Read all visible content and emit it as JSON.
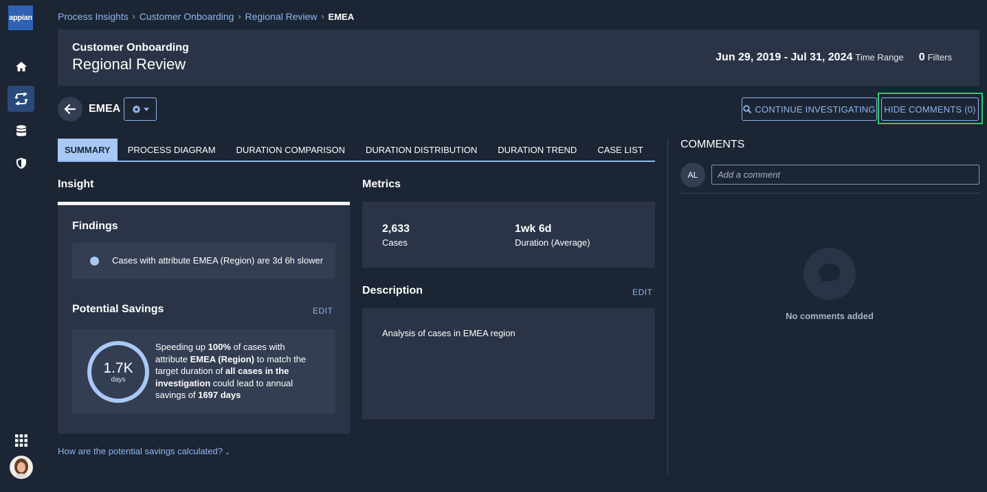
{
  "app": {
    "logo_text": "appian"
  },
  "breadcrumb": {
    "items": [
      "Process Insights",
      "Customer Onboarding",
      "Regional Review"
    ],
    "current": "EMEA"
  },
  "header": {
    "title": "Customer Onboarding",
    "subtitle": "Regional Review",
    "date_range": "Jun 29, 2019 - Jul 31, 2024",
    "date_range_label": "Time Range",
    "filter_count": "0",
    "filter_label": "Filters"
  },
  "page": {
    "title": "EMEA",
    "continue_label": "CONTINUE INVESTIGATING",
    "hide_comments_label": "HIDE COMMENTS (0)"
  },
  "tabs": [
    {
      "label": "SUMMARY",
      "active": true
    },
    {
      "label": "PROCESS DIAGRAM"
    },
    {
      "label": "DURATION COMPARISON"
    },
    {
      "label": "DURATION DISTRIBUTION"
    },
    {
      "label": "DURATION TREND"
    },
    {
      "label": "CASE LIST"
    }
  ],
  "insight": {
    "heading": "Insight",
    "findings_heading": "Findings",
    "finding": "Cases with attribute EMEA (Region) are 3d 6h slower",
    "savings_heading": "Potential Savings",
    "edit_label": "EDIT",
    "savings_value": "1.7K",
    "savings_unit": "days",
    "savings_text": {
      "p1": "Speeding up ",
      "b1": "100%",
      "p2": " of cases with attribute ",
      "b2": "EMEA (Region)",
      "p3": " to match the target duration of ",
      "b3": "all cases in the investigation",
      "p4": " could lead to annual savings of ",
      "b4": "1697 days"
    },
    "how_link": "How are the potential savings calculated?"
  },
  "metrics": {
    "heading": "Metrics",
    "cases_value": "2,633",
    "cases_label": "Cases",
    "duration_value": "1wk 6d",
    "duration_label": "Duration (Average)"
  },
  "description": {
    "heading": "Description",
    "edit_label": "EDIT",
    "text": "Analysis of cases in EMEA region"
  },
  "comments": {
    "heading": "COMMENTS",
    "avatar_initials": "AL",
    "input_placeholder": "Add a comment",
    "empty_text": "No comments added"
  },
  "colors": {
    "background": "#1c2533",
    "card": "#2a3446",
    "accent": "#8fb7f0",
    "highlight": "#2ecc71"
  },
  "icons": [
    "home-icon",
    "process-icon",
    "database-icon",
    "shield-icon",
    "grid-icon",
    "back-arrow-icon",
    "gear-icon",
    "search-icon",
    "chat-bubble-icon"
  ]
}
